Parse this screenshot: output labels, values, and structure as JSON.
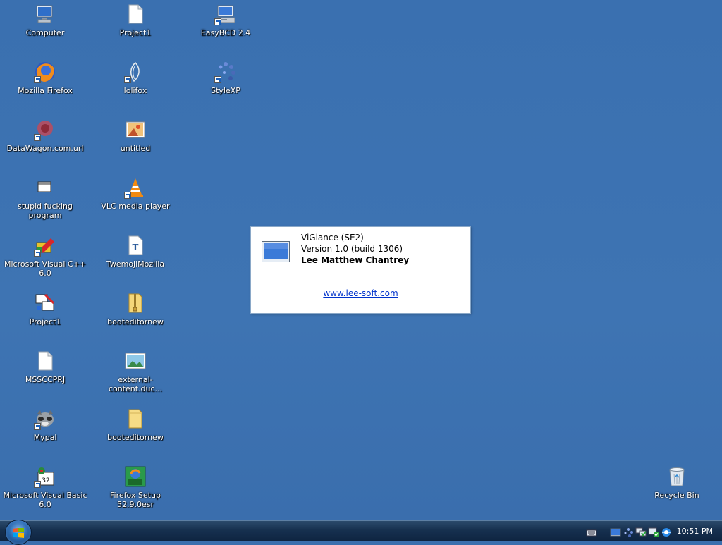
{
  "desktop": {
    "icons": [
      {
        "label": "Computer"
      },
      {
        "label": "Project1"
      },
      {
        "label": "EasyBCD 2.4"
      },
      {
        "label": "Mozilla Firefox"
      },
      {
        "label": "lolifox"
      },
      {
        "label": "StyleXP"
      },
      {
        "label": "DataWagon.com.url"
      },
      {
        "label": "untitled"
      },
      {
        "label": "stupid fucking program"
      },
      {
        "label": "VLC media player"
      },
      {
        "label": "Microsoft Visual C++ 6.0"
      },
      {
        "label": "TwemojiMozilla"
      },
      {
        "label": "Project1"
      },
      {
        "label": "booteditornew"
      },
      {
        "label": "MSSCCPRJ"
      },
      {
        "label": "external-content.duc..."
      },
      {
        "label": "Mypal"
      },
      {
        "label": "booteditornew"
      },
      {
        "label": "Microsoft Visual Basic 6.0"
      },
      {
        "label": "Firefox Setup 52.9.0esr"
      },
      {
        "label": "Recycle Bin"
      }
    ]
  },
  "dialog": {
    "title": "ViGlance (SE2)",
    "version": "Version 1.0 (build 1306)",
    "author": "Lee Matthew Chantrey",
    "link": "www.lee-soft.com"
  },
  "taskbar": {
    "clock": "10:51 PM"
  },
  "colors": {
    "desktop": "#3b6fae",
    "link": "#0033cc"
  }
}
